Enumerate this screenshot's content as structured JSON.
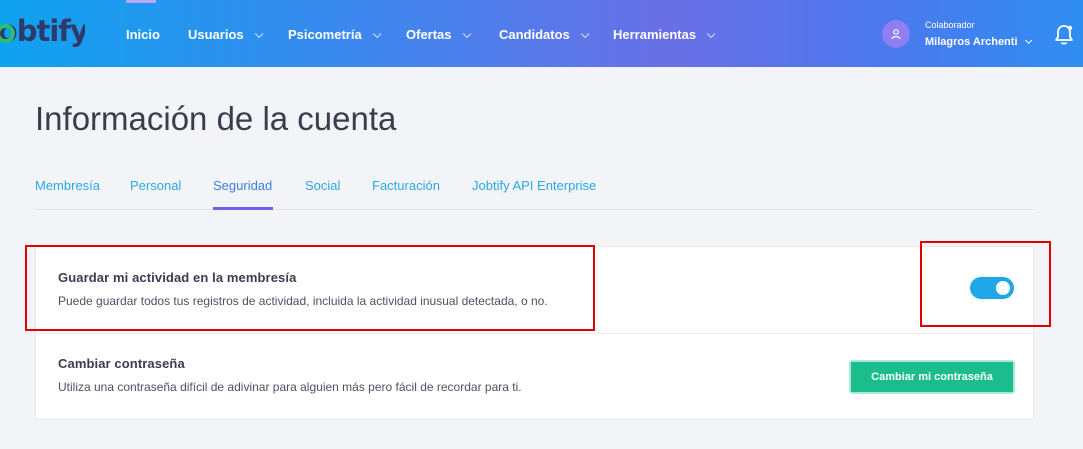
{
  "brand": {
    "logo_text": "Jobtify",
    "logo_mark_color": "#2cbf6d"
  },
  "nav": {
    "items": [
      {
        "label": "Inicio",
        "has_dropdown": false
      },
      {
        "label": "Usuarios",
        "has_dropdown": true
      },
      {
        "label": "Psicometría",
        "has_dropdown": true
      },
      {
        "label": "Ofertas",
        "has_dropdown": true
      },
      {
        "label": "Candidatos",
        "has_dropdown": true
      },
      {
        "label": "Herramientas",
        "has_dropdown": true
      }
    ],
    "gradient_colors": [
      "#0ea3ef",
      "#6a6fe6",
      "#2f8ef0"
    ]
  },
  "user": {
    "role": "Colaborador",
    "name": "Milagros Archenti",
    "avatar_icon": "user-icon",
    "avatar_color": "#8f7ff2"
  },
  "notifications": {
    "icon": "bell-icon"
  },
  "page": {
    "title": "Información de la cuenta"
  },
  "tabs": [
    {
      "label": "Membresía",
      "active": false
    },
    {
      "label": "Personal",
      "active": false
    },
    {
      "label": "Seguridad",
      "active": true
    },
    {
      "label": "Social",
      "active": false
    },
    {
      "label": "Facturación",
      "active": false
    },
    {
      "label": "Jobtify API Enterprise",
      "active": false
    }
  ],
  "settings": {
    "activity": {
      "title": "Guardar mi actividad en la membresía",
      "description": "Puede guardar todos tus registros de actividad, incluida la actividad inusual detectada, o no.",
      "toggle_on": true,
      "toggle_color": "#1fa7e8"
    },
    "password": {
      "title": "Cambiar contraseña",
      "description": "Utiliza una contraseña difícil de adivinar para alguien más pero fácil de recordar para ti.",
      "button_label": "Cambiar mi contraseña",
      "button_color": "#1bbd8c"
    }
  },
  "annotations": {
    "highlight_color": "#e30000"
  }
}
